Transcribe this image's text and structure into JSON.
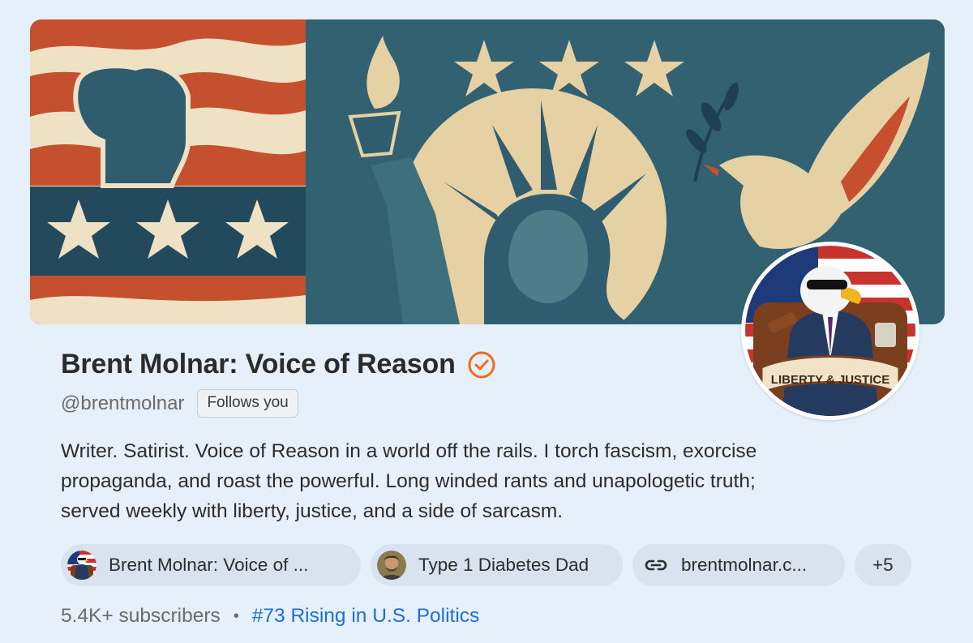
{
  "profile": {
    "name": "Brent Molnar: Voice of Reason",
    "handle": "@brentmolnar",
    "follows_badge": "Follows you",
    "bio_lines": [
      "Writer. Satirist. Voice of Reason in a world off the rails. I torch fascism, exorcise",
      "propaganda, and roast the powerful. Long winded rants and unapologetic truth;",
      "served weekly with liberty, justice, and a side of sarcasm."
    ],
    "avatar_text": "LIBERTY & JUSTICE"
  },
  "chips": [
    {
      "label": "Brent Molnar: Voice of ...",
      "icon": "eagle-avatar"
    },
    {
      "label": "Type 1 Diabetes Dad",
      "icon": "person-avatar"
    },
    {
      "label": "brentmolnar.c...",
      "icon": "link-icon"
    },
    {
      "label": "+5"
    }
  ],
  "stats": {
    "subscribers": "5.4K+ subscribers",
    "separator": "•",
    "ranking": "#73 Rising in U.S. Politics"
  },
  "colors": {
    "verified": "#f26a1b",
    "link": "#1d6fd6",
    "chip_bg": "#d9e3ef",
    "page_bg": "#e6f0fb"
  }
}
